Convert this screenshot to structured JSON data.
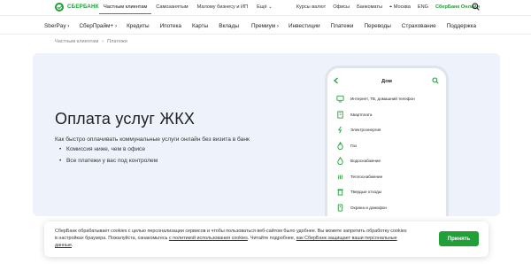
{
  "brand": {
    "name": "СБЕРБАНК",
    "accent": "#21a038"
  },
  "top_nav": [
    "Частным клиентам",
    "Самозанятым",
    "Малому бизнесу и ИП",
    "Ещё"
  ],
  "top_right": {
    "rates": "Курсы валют",
    "offices": "Офисы",
    "atms": "Банкоматы",
    "city": "Москва",
    "lang": "ENG",
    "online": "СберБанк Онлайн"
  },
  "main_nav": [
    "SberPay",
    "СберПрайм+",
    "Кредиты",
    "Ипотека",
    "Карты",
    "Вклады",
    "Премиум",
    "Инвестиции",
    "Платежи",
    "Переводы",
    "Страхование",
    "Поддержка"
  ],
  "breadcrumb": [
    "Частным клиентам",
    "Платежи"
  ],
  "hero": {
    "title": "Оплата услуг ЖКХ",
    "subtitle": "Как быстро оплачивать коммунальные услуги онлайн без визита в банк",
    "bullets": [
      "Комиссия ниже, чем в офисе",
      "Все платежи у вас под контролем"
    ]
  },
  "phone": {
    "title": "Дом",
    "items": [
      "Интернет, ТВ, домашний телефон",
      "Квартплата",
      "Электроэнергия",
      "Газ",
      "Водоснабжение",
      "Теплоснабжение",
      "Твердые отходы",
      "Охрана и домофон"
    ]
  },
  "cookie": {
    "text1": "СберБанк обрабатывает cookies с целью персонализации сервисов и чтобы пользоваться веб-сайтом было удобнее. Вы можете запретить обработку cookies в настройках браузера. Пожалуйста, ознакомьтесь ",
    "link1": "с политикой использования cookies",
    "text2": ". Читайте подробнее, ",
    "link2": "как СберБанк защищает ваши персональные данные",
    "text3": ".",
    "accept": "Принять"
  }
}
